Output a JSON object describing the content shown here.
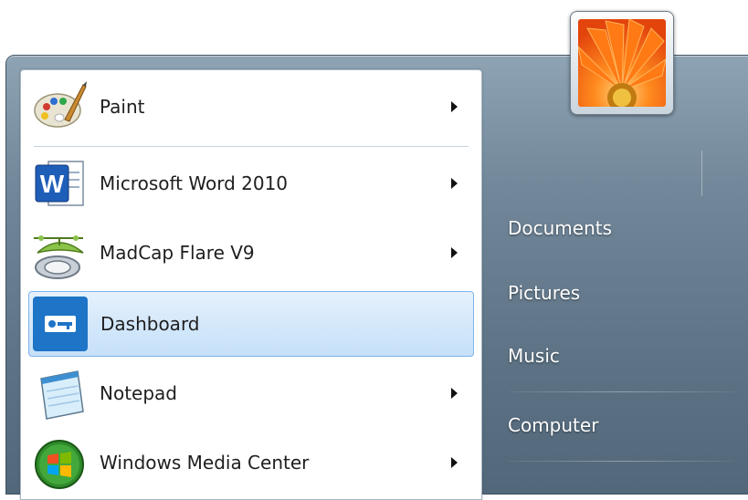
{
  "programs": [
    {
      "label": "Paint",
      "icon": "paint-palette-icon",
      "has_submenu": true,
      "selected": false
    },
    {
      "label": "Microsoft Word 2010",
      "icon": "microsoft-word-icon",
      "has_submenu": true,
      "selected": false
    },
    {
      "label": "MadCap Flare V9",
      "icon": "madcap-flare-icon",
      "has_submenu": true,
      "selected": false
    },
    {
      "label": "Dashboard",
      "icon": "dashboard-key-icon",
      "has_submenu": false,
      "selected": true
    },
    {
      "label": "Notepad",
      "icon": "notepad-icon",
      "has_submenu": true,
      "selected": false
    },
    {
      "label": "Windows Media Center",
      "icon": "windows-media-center-icon",
      "has_submenu": true,
      "selected": false
    }
  ],
  "right_pane": {
    "user_picture": "flower-user-picture",
    "items": [
      "Documents",
      "Pictures",
      "Music",
      "Computer"
    ]
  },
  "colors": {
    "selection_border": "#7eb4ea",
    "selection_fill": "#d4e8fb",
    "frame_top": "#8ea3b3",
    "frame_bottom": "#52687a"
  }
}
